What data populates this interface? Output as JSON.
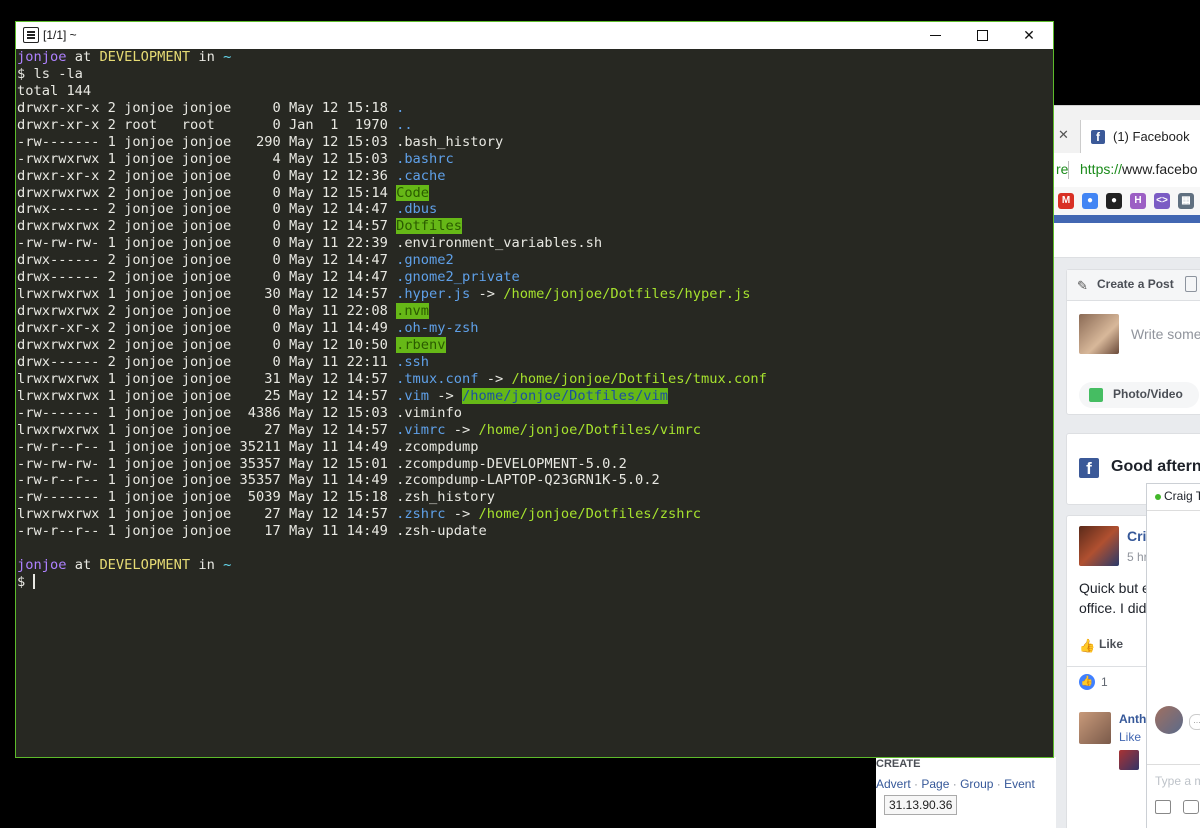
{
  "terminal": {
    "title": "[1/1] ~",
    "prompt1": {
      "user": "jonjoe",
      "at": "at",
      "host": "DEVELOPMENT",
      "in": "in",
      "dir": "~"
    },
    "command": "$ ls -la",
    "total": "total 144",
    "entries": [
      {
        "meta": "drwxr-xr-x 2 jonjoe jonjoe     0 May 12 15:18 ",
        "name": ".",
        "style": "dir"
      },
      {
        "meta": "drwxr-xr-x 2 root   root       0 Jan  1  1970 ",
        "name": "..",
        "style": "dir"
      },
      {
        "meta": "-rw------- 1 jonjoe jonjoe   290 May 12 15:03 ",
        "name": ".bash_history",
        "style": "file"
      },
      {
        "meta": "-rwxrwxrwx 1 jonjoe jonjoe     4 May 12 15:03 ",
        "name": ".bashrc",
        "style": "dir"
      },
      {
        "meta": "drwxr-xr-x 2 jonjoe jonjoe     0 May 12 12:36 ",
        "name": ".cache",
        "style": "dir"
      },
      {
        "meta": "drwxrwxrwx 2 jonjoe jonjoe     0 May 12 15:14 ",
        "name": "Code",
        "style": "hl"
      },
      {
        "meta": "drwx------ 2 jonjoe jonjoe     0 May 12 14:47 ",
        "name": ".dbus",
        "style": "dir"
      },
      {
        "meta": "drwxrwxrwx 2 jonjoe jonjoe     0 May 12 14:57 ",
        "name": "Dotfiles",
        "style": "hl"
      },
      {
        "meta": "-rw-rw-rw- 1 jonjoe jonjoe     0 May 11 22:39 ",
        "name": ".environment_variables.sh",
        "style": "file"
      },
      {
        "meta": "drwx------ 2 jonjoe jonjoe     0 May 12 14:47 ",
        "name": ".gnome2",
        "style": "dir"
      },
      {
        "meta": "drwx------ 2 jonjoe jonjoe     0 May 12 14:47 ",
        "name": ".gnome2_private",
        "style": "dir"
      },
      {
        "meta": "lrwxrwxrwx 1 jonjoe jonjoe    30 May 12 14:57 ",
        "name": ".hyper.js",
        "style": "link",
        "arrow": " -> ",
        "target": "/home/jonjoe/Dotfiles/hyper.js",
        "target_style": "tgt"
      },
      {
        "meta": "drwxrwxrwx 2 jonjoe jonjoe     0 May 11 22:08 ",
        "name": ".nvm",
        "style": "hl"
      },
      {
        "meta": "drwxr-xr-x 2 jonjoe jonjoe     0 May 11 14:49 ",
        "name": ".oh-my-zsh",
        "style": "dir"
      },
      {
        "meta": "drwxrwxrwx 2 jonjoe jonjoe     0 May 12 10:50 ",
        "name": ".rbenv",
        "style": "hl"
      },
      {
        "meta": "drwx------ 2 jonjoe jonjoe     0 May 11 22:11 ",
        "name": ".ssh",
        "style": "dir"
      },
      {
        "meta": "lrwxrwxrwx 1 jonjoe jonjoe    31 May 12 14:57 ",
        "name": ".tmux.conf",
        "style": "link",
        "arrow": " -> ",
        "target": "/home/jonjoe/Dotfiles/tmux.conf",
        "target_style": "tgt"
      },
      {
        "meta": "lrwxrwxrwx 1 jonjoe jonjoe    25 May 12 14:57 ",
        "name": ".vim",
        "style": "link",
        "arrow": " -> ",
        "target": "/home/jonjoe/Dotfiles/vim",
        "target_style": "hlblue"
      },
      {
        "meta": "-rw------- 1 jonjoe jonjoe  4386 May 12 15:03 ",
        "name": ".viminfo",
        "style": "file"
      },
      {
        "meta": "lrwxrwxrwx 1 jonjoe jonjoe    27 May 12 14:57 ",
        "name": ".vimrc",
        "style": "link",
        "arrow": " -> ",
        "target": "/home/jonjoe/Dotfiles/vimrc",
        "target_style": "tgt"
      },
      {
        "meta": "-rw-r--r-- 1 jonjoe jonjoe 35211 May 11 14:49 ",
        "name": ".zcompdump",
        "style": "file"
      },
      {
        "meta": "-rw-rw-rw- 1 jonjoe jonjoe 35357 May 12 15:01 ",
        "name": ".zcompdump-DEVELOPMENT-5.0.2",
        "style": "file"
      },
      {
        "meta": "-rw-r--r-- 1 jonjoe jonjoe 35357 May 11 14:49 ",
        "name": ".zcompdump-LAPTOP-Q23GRN1K-5.0.2",
        "style": "file"
      },
      {
        "meta": "-rw------- 1 jonjoe jonjoe  5039 May 12 15:18 ",
        "name": ".zsh_history",
        "style": "file"
      },
      {
        "meta": "lrwxrwxrwx 1 jonjoe jonjoe    27 May 12 14:57 ",
        "name": ".zshrc",
        "style": "link",
        "arrow": " -> ",
        "target": "/home/jonjoe/Dotfiles/zshrc",
        "target_style": "tgt"
      },
      {
        "meta": "-rw-r--r-- 1 jonjoe jonjoe    17 May 11 14:49 ",
        "name": ".zsh-update",
        "style": "file"
      }
    ],
    "prompt2": {
      "user": "jonjoe",
      "at": "at",
      "host": "DEVELOPMENT",
      "in": "in",
      "dir": "~"
    },
    "prompt_symbol": "$ "
  },
  "browser": {
    "tab_close": "✕",
    "tab_title": "(1) Facebook",
    "address_left": "re",
    "address_scheme": "https://",
    "address_rest": "www.facebo",
    "bookmarks": [
      {
        "icon": "gmail-icon",
        "glyph": "M",
        "color": "#d93025"
      },
      {
        "icon": "contacts-icon",
        "glyph": "●",
        "color": "#4285f4"
      },
      {
        "icon": "github-icon",
        "glyph": "●",
        "color": "#222222"
      },
      {
        "icon": "h-icon",
        "glyph": "H",
        "color": "#9c5fc4"
      },
      {
        "icon": "code-icon",
        "glyph": "<>",
        "color": "#7b5cc4"
      },
      {
        "icon": "grid-icon",
        "glyph": "▦",
        "color": "#607080"
      }
    ],
    "create_post": {
      "title": "Create a Post",
      "placeholder": "Write some",
      "photo_video": "Photo/Video"
    },
    "greeting": "Good aftern",
    "post": {
      "author": "Cri",
      "time": "5 hr",
      "text1": "Quick but e",
      "text2": "office. I did",
      "like": "Like",
      "reaction_count": "1",
      "comment_author": "Anth",
      "comment_like": "Like"
    },
    "chat": {
      "name": "Craig T",
      "input_placeholder": "Type a m"
    },
    "footer": {
      "create": "CREATE",
      "links": [
        "Advert",
        "Page",
        "Group",
        "Event"
      ],
      "ip": "31.13.90.36"
    }
  }
}
